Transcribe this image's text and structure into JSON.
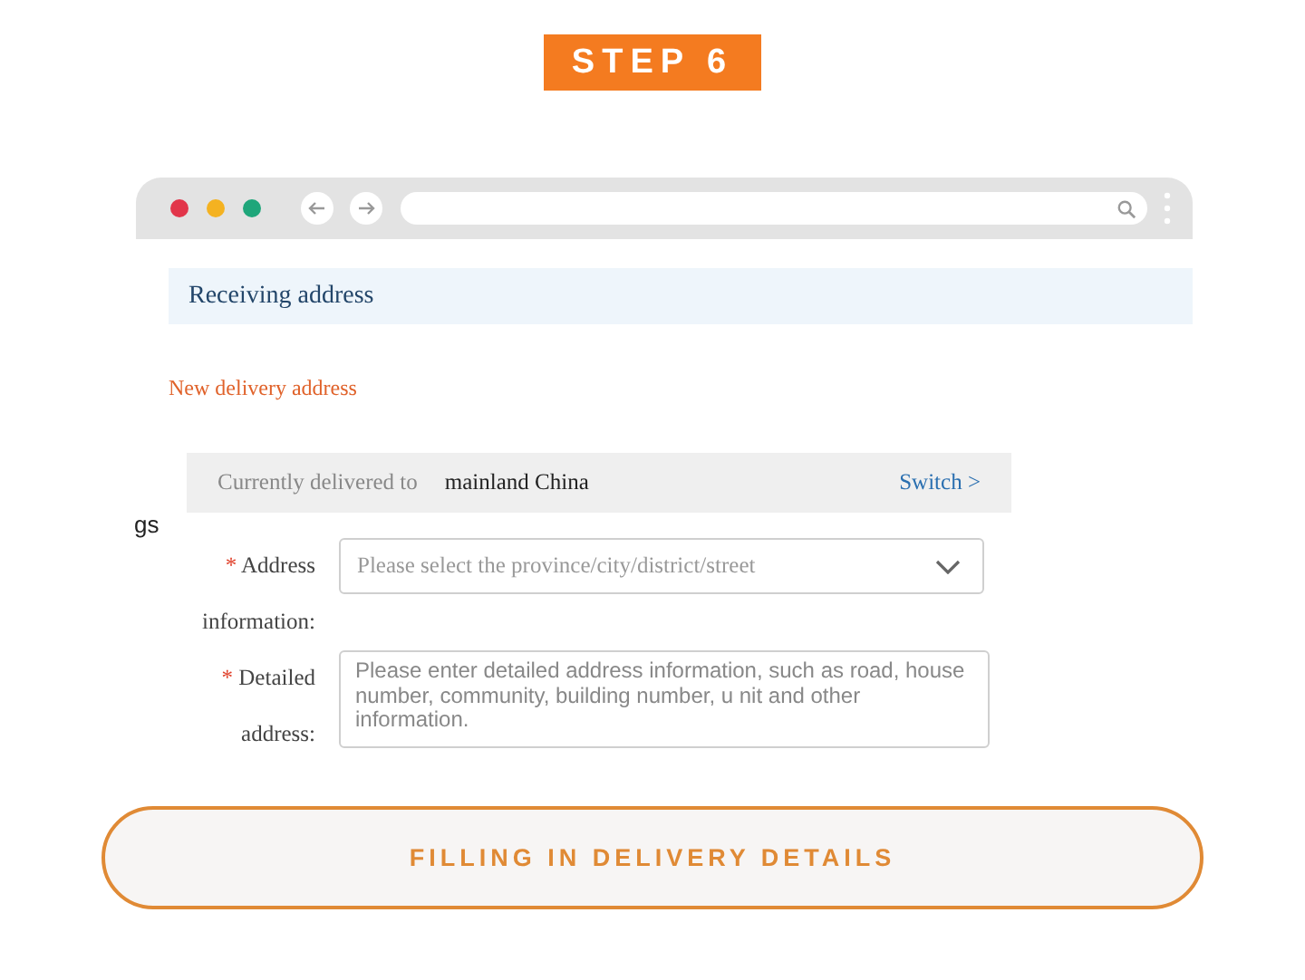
{
  "step_badge": "STEP 6",
  "browser": {
    "header": "Receiving address",
    "section_title": "New delivery address",
    "delivery": {
      "prefix": "Currently delivered to",
      "region": "mainland China",
      "link": "Switch >"
    },
    "side_fragment": "gs",
    "fields": [
      {
        "kind": "select",
        "required_mark": "*",
        "label": "Address information:",
        "placeholder": "Please select the province/city/district/street"
      },
      {
        "kind": "textarea",
        "required_mark": "*",
        "label": "Detailed address:",
        "placeholder": "Please enter detailed address information, such as road, house number, community, building number, u nit and other information."
      }
    ]
  },
  "caption_button": "FILLING IN DELIVERY DETAILS"
}
